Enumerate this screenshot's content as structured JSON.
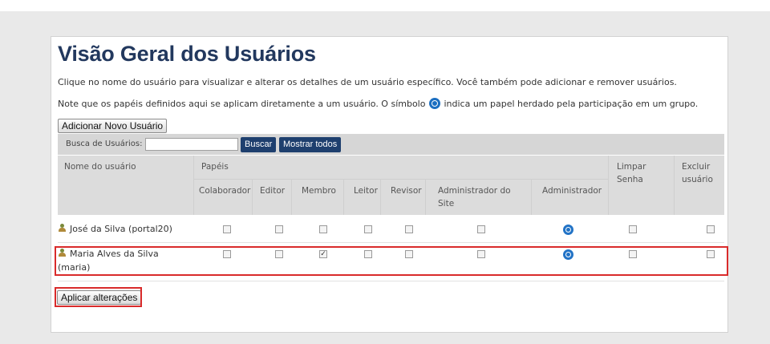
{
  "page": {
    "title": "Visão Geral dos Usuários",
    "description_1": "Clique no nome do usuário para visualizar e alterar os detalhes de um usuário específico. Você também pode adicionar e remover usuários.",
    "description_2_before": "Note que os papéis definidos aqui se aplicam diretamente a um usuário. O símbolo",
    "description_2_after": "indica um papel herdado pela participação em um grupo."
  },
  "buttons": {
    "add_user": "Adicionar Novo Usuário",
    "search": "Buscar",
    "show_all": "Mostrar todos",
    "apply": "Aplicar alterações"
  },
  "search": {
    "label": "Busca de Usuários:",
    "value": ""
  },
  "table": {
    "col_user": "Nome do usuário",
    "col_roles": "Papéis",
    "roles": [
      "Colaborador",
      "Editor",
      "Membro",
      "Leitor",
      "Revisor",
      "Administrador do Site",
      "Administrador"
    ],
    "col_reset": "Limpar Senha",
    "col_delete": "Excluir usuário",
    "rows": [
      {
        "name": "José da Silva (portal20)",
        "roles_checked": [
          false,
          false,
          false,
          false,
          false,
          false
        ],
        "admin_inherited": true,
        "reset": false,
        "delete": false
      },
      {
        "name": "Maria Alves da Silva (maria)",
        "roles_checked": [
          false,
          false,
          true,
          false,
          false,
          false
        ],
        "admin_inherited": true,
        "reset": false,
        "delete": false
      }
    ]
  },
  "icons": {
    "user": "user-icon",
    "inherited_role": "inherited-role-icon"
  },
  "colors": {
    "title": "#22385e",
    "dark_button": "#1e3f6e",
    "highlight": "#d92b2b",
    "inherited_icon": "#2273c6"
  }
}
